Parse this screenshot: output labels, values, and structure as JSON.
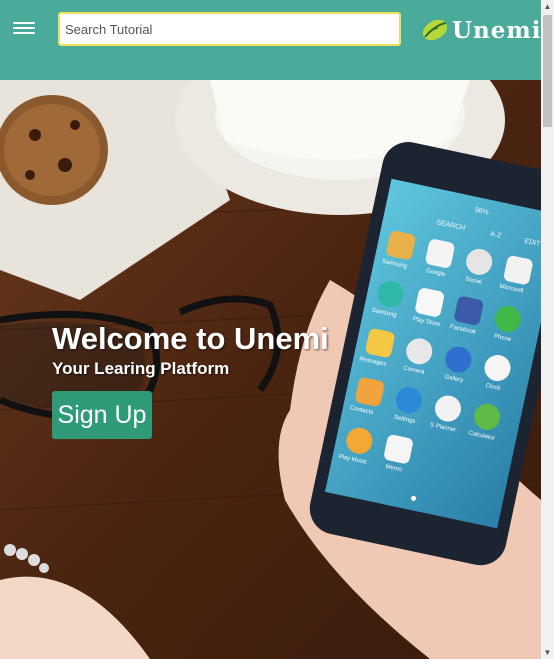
{
  "header": {
    "search_placeholder": "Search Tutorial",
    "logo_text": "Unemi",
    "menu_icon": "hamburger-menu-icon"
  },
  "hero": {
    "title": "Welcome to Unemi",
    "subtitle": "Your Learing Platform",
    "signup_label": "Sign Up",
    "phone": {
      "tabs": [
        "SEARCH",
        "A-Z",
        "EDIT"
      ],
      "status": "96%",
      "apps": [
        "Samsung",
        "Google",
        "Social",
        "Microsoft Apps",
        "Samsung Members",
        "Play Store",
        "Facebook",
        "Phone",
        "Messages",
        "Camera",
        "Gallery",
        "Clock",
        "Contacts",
        "Settings",
        "S Planner",
        "Calculator",
        "Play Music",
        "Memo"
      ],
      "calendar_day": "29"
    }
  },
  "colors": {
    "header_bg": "#4aab9a",
    "search_border": "#f0e05c",
    "button_bg": "#2f9a77"
  }
}
